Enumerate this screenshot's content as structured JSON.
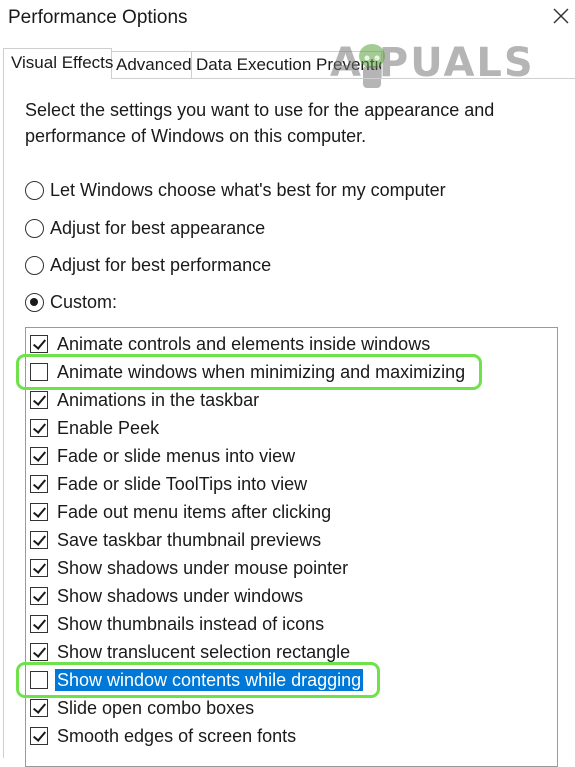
{
  "window": {
    "title": "Performance Options"
  },
  "tabs": [
    {
      "label": "Visual Effects",
      "active": true
    },
    {
      "label": "Advanced",
      "active": false
    },
    {
      "label": "Data Execution Prevention",
      "active": false
    }
  ],
  "intro_text": "Select the settings you want to use for the appearance and performance of Windows on this computer.",
  "options": [
    {
      "label": "Let Windows choose what's best for my computer",
      "selected": false
    },
    {
      "label": "Adjust for best appearance",
      "selected": false
    },
    {
      "label": "Adjust for best performance",
      "selected": false
    },
    {
      "label": "Custom:",
      "selected": true
    }
  ],
  "settings": [
    {
      "label": "Animate controls and elements inside windows",
      "checked": true
    },
    {
      "label": "Animate windows when minimizing and maximizing",
      "checked": false,
      "highlighted": true
    },
    {
      "label": "Animations in the taskbar",
      "checked": true
    },
    {
      "label": "Enable Peek",
      "checked": true
    },
    {
      "label": "Fade or slide menus into view",
      "checked": true
    },
    {
      "label": "Fade or slide ToolTips into view",
      "checked": true
    },
    {
      "label": "Fade out menu items after clicking",
      "checked": true
    },
    {
      "label": "Save taskbar thumbnail previews",
      "checked": true
    },
    {
      "label": "Show shadows under mouse pointer",
      "checked": true
    },
    {
      "label": "Show shadows under windows",
      "checked": true
    },
    {
      "label": "Show thumbnails instead of icons",
      "checked": true
    },
    {
      "label": "Show translucent selection rectangle",
      "checked": true
    },
    {
      "label": "Show window contents while dragging",
      "checked": false,
      "highlighted": true,
      "selected": true
    },
    {
      "label": "Slide open combo boxes",
      "checked": true
    },
    {
      "label": "Smooth edges of screen fonts",
      "checked": true
    }
  ],
  "watermark": {
    "text": "A  PUALS"
  },
  "colors": {
    "highlight_outline": "#6ee24a",
    "selection_bg": "#0078d7"
  },
  "icons": {
    "close": "close-icon"
  }
}
